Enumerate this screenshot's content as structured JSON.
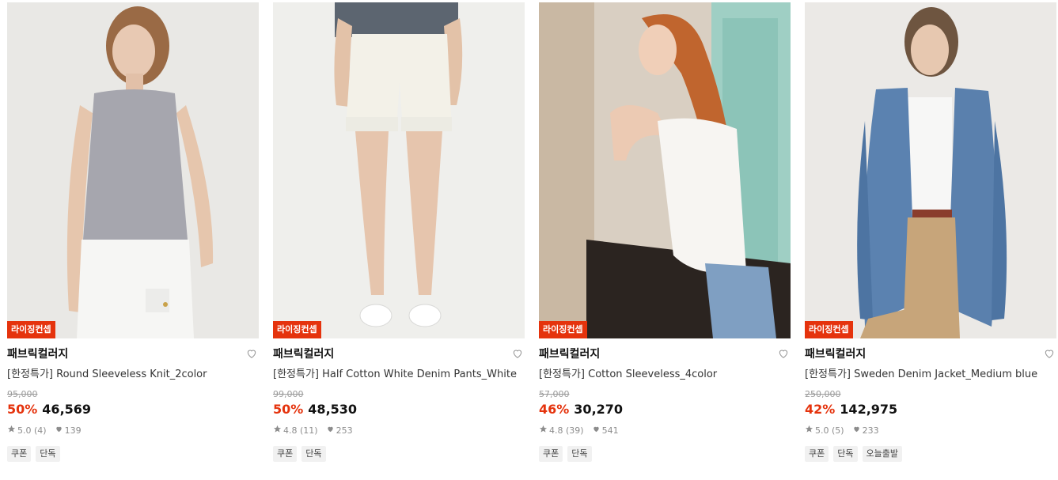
{
  "products": [
    {
      "badge": "라이징컨셉",
      "brand": "패브릭컬러지",
      "name": "[한정특가] Round Sleeveless Knit_2color",
      "original_price": "95,000",
      "discount": "50%",
      "price": "46,569",
      "rating": "5.0",
      "reviews": "(4)",
      "likes": "139",
      "tags": [
        "쿠폰",
        "단독"
      ],
      "image_desc": "Model in grey sleeveless knit top and white skirt"
    },
    {
      "badge": "라이징컨셉",
      "brand": "패브릭컬러지",
      "name": "[한정특가] Half Cotton White Denim Pants_White",
      "original_price": "99,000",
      "discount": "50%",
      "price": "48,530",
      "rating": "4.8",
      "reviews": "(11)",
      "likes": "253",
      "tags": [
        "쿠폰",
        "단독"
      ],
      "image_desc": "Model in white denim shorts and white sneakers"
    },
    {
      "badge": "라이징컨셉",
      "brand": "패브릭컬러지",
      "name": "[한정특가] Cotton Sleeveless_4color",
      "original_price": "57,000",
      "discount": "46%",
      "price": "30,270",
      "rating": "4.8",
      "reviews": "(39)",
      "likes": "541",
      "tags": [
        "쿠폰",
        "단독"
      ],
      "image_desc": "Red-haired model in white cotton sleeveless top"
    },
    {
      "badge": "라이징컨셉",
      "brand": "패브릭컬러지",
      "name": "[한정특가] Sweden Denim Jacket_Medium blue",
      "original_price": "250,000",
      "discount": "42%",
      "price": "142,975",
      "rating": "5.0",
      "reviews": "(5)",
      "likes": "233",
      "tags": [
        "쿠폰",
        "단독",
        "오늘출발"
      ],
      "image_desc": "Model in medium blue denim jacket and beige pants"
    }
  ],
  "colors": {
    "accent": "#e5330d",
    "badge_bg": "#e5330d",
    "tag_bg": "#f1f1f1"
  }
}
